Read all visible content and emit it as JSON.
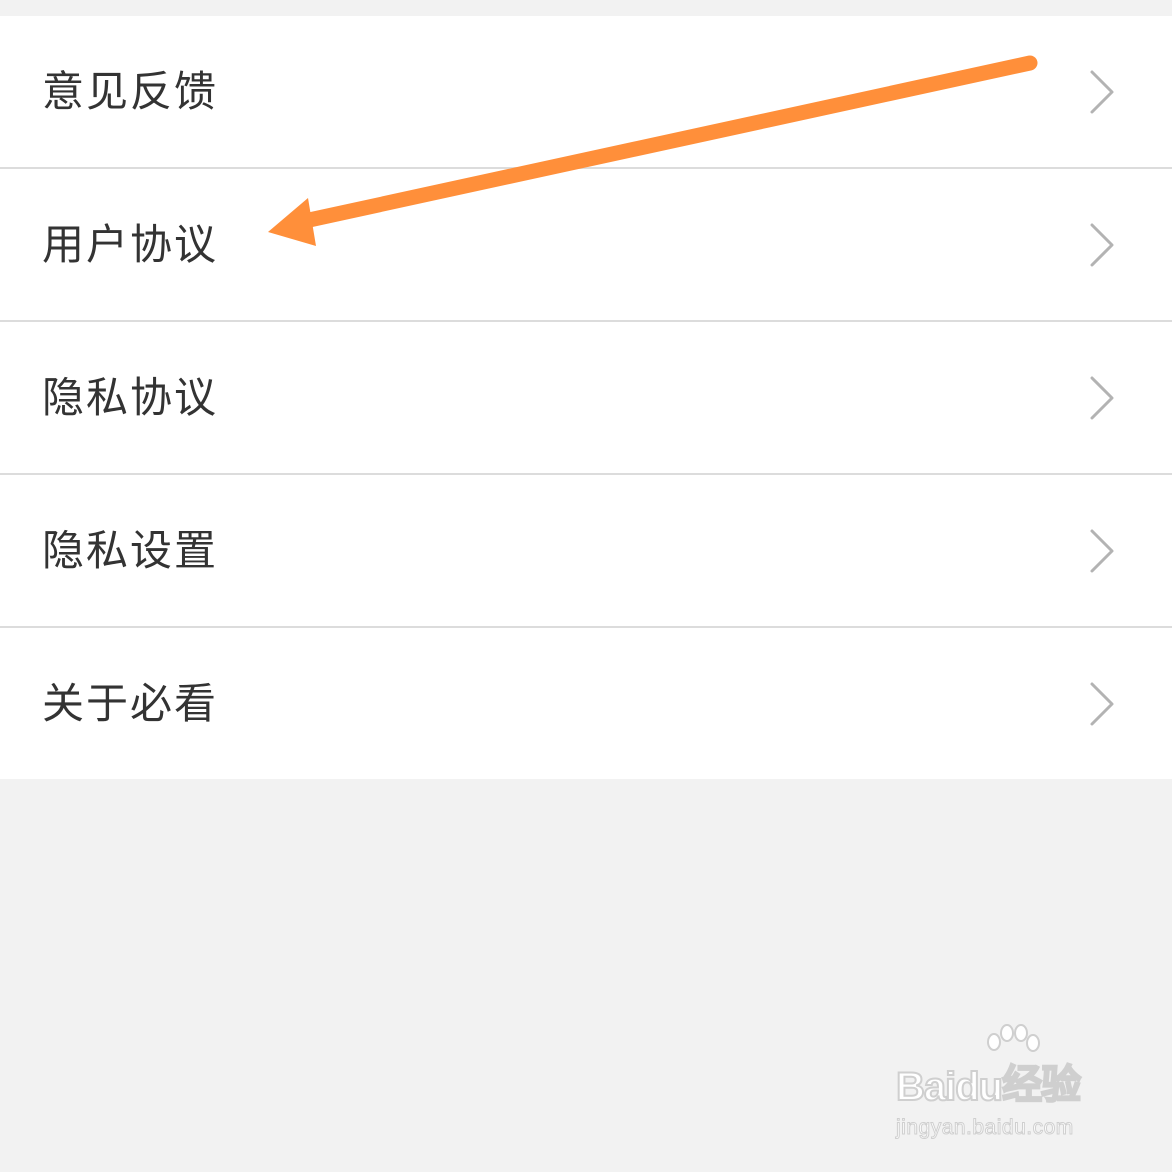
{
  "menu": {
    "items": [
      {
        "label": "意见反馈"
      },
      {
        "label": "用户协议"
      },
      {
        "label": "隐私协议"
      },
      {
        "label": "隐私设置"
      },
      {
        "label": "关于必看"
      }
    ]
  },
  "annotation": {
    "arrow_color": "#ff8f3a",
    "points_to": "用户协议"
  },
  "watermark": {
    "logo_text_left": "Bai",
    "logo_text_mid": "du",
    "logo_text_right": "经验",
    "url": "jingyan.baidu.com"
  },
  "colors": {
    "background": "#f2f2f2",
    "card": "#ffffff",
    "divider": "#dcdcdc",
    "text": "#333333",
    "chevron": "#b3b3b3"
  }
}
